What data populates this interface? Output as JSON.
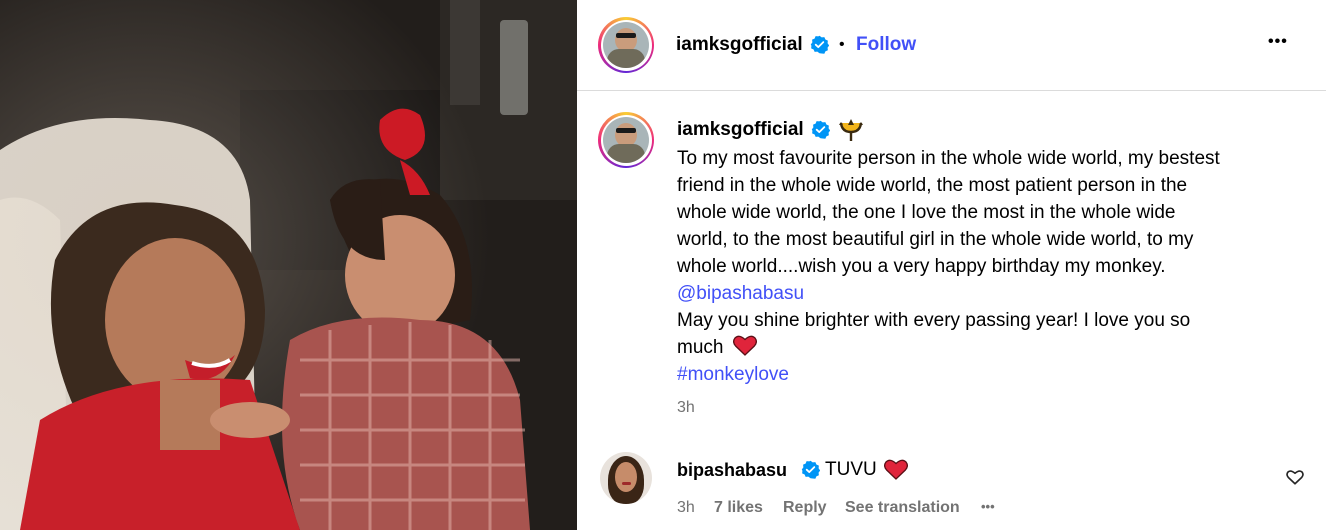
{
  "post_author": {
    "username": "iamksgofficial",
    "separator": "•",
    "follow_label": "Follow",
    "more_label": "•••"
  },
  "caption": {
    "username": "iamksgofficial",
    "lines": [
      "To my most favourite person in the whole wide world, my bestest",
      "friend in the whole wide world, the most patient person in the",
      "whole wide world, the one I love the most in the whole wide",
      "world, to the most beautiful girl in the whole wide world, to my",
      "whole world....wish you a very happy birthday my monkey."
    ],
    "mention": "@bipashabasu",
    "line_after_1": "May you shine brighter with every passing year! I love you so",
    "line_after_2": "much",
    "hashtag": "#monkeylove",
    "time": "3h"
  },
  "comment": {
    "username": "bipashabasu",
    "text": "TUVU",
    "time": "3h",
    "likes": "7 likes",
    "reply_label": "Reply",
    "translate_label": "See translation",
    "more_label": "•••"
  },
  "colors": {
    "link": "#4150f7",
    "verified": "#0095f6",
    "heart": "#e0243b",
    "meta": "#737373"
  }
}
